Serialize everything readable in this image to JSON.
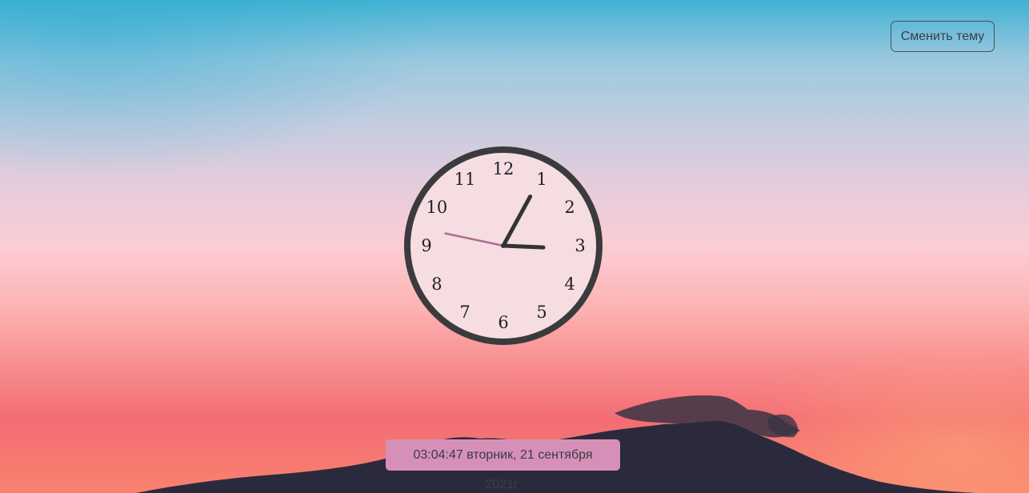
{
  "header": {
    "theme_button_label": "Сменить тему"
  },
  "clock": {
    "time": {
      "hours": 3,
      "minutes": 4,
      "seconds": 47
    },
    "numbers": [
      "12",
      "1",
      "2",
      "3",
      "4",
      "5",
      "6",
      "7",
      "8",
      "9",
      "10",
      "11"
    ],
    "colors": {
      "face": "#f6dde2",
      "rim": "#3b3b3e",
      "hands": "#333336",
      "second_hand": "#a9708f"
    }
  },
  "datetime": {
    "text": "03:04:47 вторник, 21 сентября",
    "year": "2021г"
  },
  "colors": {
    "datetime_bar": "#d690b8",
    "mountain": "#2b2a3c"
  }
}
